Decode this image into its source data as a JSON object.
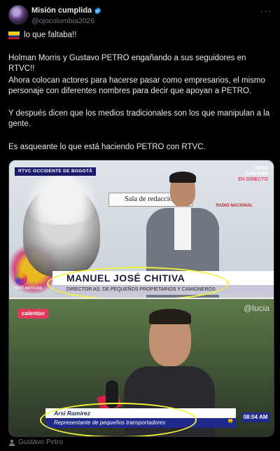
{
  "header": {
    "display_name": "Misión cumplida",
    "handle": "@ojocolombia2026",
    "more_label": "···"
  },
  "post": {
    "line1": "lo que faltaba!!",
    "paragraph2": "Holman Morris y Gustavo PETRO engañando a sus seguidores en RTVC!!",
    "paragraph3": "Ahora colocan actores para hacerse pasar como empresarios, el mismo personaje con diferentes nombres para decir que apoyan a PETRO.",
    "paragraph4": "Y después dicen que los medios tradicionales son los que manipulan a la gente.",
    "paragraph5": "Es asqueante lo que está haciendo PETRO con RTVC."
  },
  "media": {
    "top": {
      "channel_tag": "RTVC  OCCIDENTE DE BOGOTÁ",
      "sign_text": "Sala de redacción",
      "senal_line1": "Señal",
      "senal_line2": "Colombia",
      "senal_line3": "EN DIRECTO",
      "radio_text": "RADIO NACIONAL",
      "bug_text": "RTVC NOTICIAS",
      "name": "MANUEL JOSÉ CHITIVA",
      "role": "DIRECTOR AS. DE PEQUEÑOS PROPIETARIOS Y CAMIONEROS"
    },
    "bottom": {
      "show_tag": "calentao",
      "watermark": "@lucia",
      "name": "Arsi Ramírez",
      "role": "Representante de pequeños transportadores",
      "accent": "❞",
      "time": "08:04 AM"
    }
  },
  "footer": {
    "label": "Gustavo Petro"
  },
  "colors": {
    "background": "#000000",
    "text": "#e7e9ea",
    "muted": "#71767b",
    "verified": "#1d9bf0",
    "annotation": "#f2f23a"
  }
}
